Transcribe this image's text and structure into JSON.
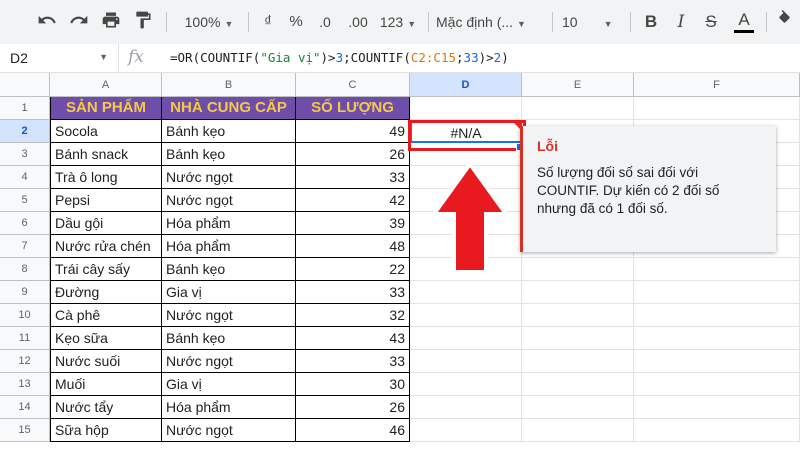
{
  "toolbar": {
    "zoom": "100%",
    "currency": "₫",
    "percent": "%",
    "decimal_decrease": ".0",
    "decimal_increase": ".00",
    "number_format": "123",
    "font": "Mặc định (...",
    "font_size": "10"
  },
  "formula_bar": {
    "cell_ref": "D2",
    "fx": "fx",
    "parts": {
      "p1": "=OR(COUNTIF(",
      "p2": "\"Gia vị\"",
      "p3": ")>",
      "p4": "3",
      "p5": ";COUNTIF(",
      "p6": "C2:C15",
      "p7": ";",
      "p8": "33",
      "p9": ")>",
      "p10": "2",
      "p11": ")"
    }
  },
  "columns": [
    "A",
    "B",
    "C",
    "D",
    "E",
    "F"
  ],
  "rows": [
    "1",
    "2",
    "3",
    "4",
    "5",
    "6",
    "7",
    "8",
    "9",
    "10",
    "11",
    "12",
    "13",
    "14",
    "15"
  ],
  "headers": {
    "a": "SẢN PHẨM",
    "b": "NHÀ CUNG CẤP",
    "c": "SỐ LƯỢNG"
  },
  "data": [
    {
      "a": "Socola",
      "b": "Bánh kẹo",
      "c": "49"
    },
    {
      "a": "Bánh snack",
      "b": "Bánh kẹo",
      "c": "26"
    },
    {
      "a": "Trà ô long",
      "b": "Nước ngọt",
      "c": "33"
    },
    {
      "a": "Pepsi",
      "b": "Nước ngọt",
      "c": "42"
    },
    {
      "a": "Dầu gội",
      "b": "Hóa phẩm",
      "c": "39"
    },
    {
      "a": "Nước rửa chén",
      "b": "Hóa phẩm",
      "c": "48"
    },
    {
      "a": "Trái cây sấy",
      "b": "Bánh kẹo",
      "c": "22"
    },
    {
      "a": "Đường",
      "b": "Gia vị",
      "c": "33"
    },
    {
      "a": "Cà phê",
      "b": "Nước ngọt",
      "c": "32"
    },
    {
      "a": "Kẹo sữa",
      "b": "Bánh kẹo",
      "c": "43"
    },
    {
      "a": "Nước suối",
      "b": "Nước ngọt",
      "c": "33"
    },
    {
      "a": "Muối",
      "b": "Gia vị",
      "c": "30"
    },
    {
      "a": "Nước tẩy",
      "b": "Hóa phẩm",
      "c": "26"
    },
    {
      "a": "Sữa hộp",
      "b": "Nước ngọt",
      "c": "46"
    }
  ],
  "d2_value": "#N/A",
  "error_tooltip": {
    "title": "Lỗi",
    "message": "Số lượng đối số sai đối với COUNTIF. Dự kiến có 2 đối số nhưng đã có 1 đối số."
  },
  "colors": {
    "header_bg": "#6e4ea9",
    "header_text": "#f4c94a",
    "error_red": "#d93025",
    "highlight_red": "#e8191f",
    "selection_blue": "#1a73e8"
  }
}
